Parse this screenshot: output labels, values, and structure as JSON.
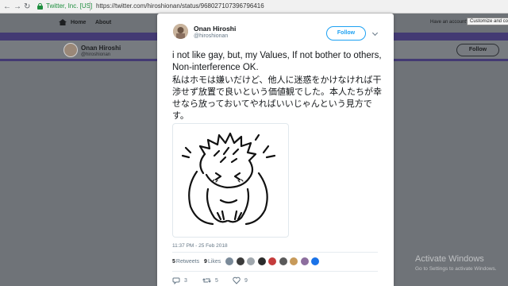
{
  "browser": {
    "back_icon": "back-arrow-icon",
    "forward_icon": "forward-arrow-icon",
    "reload_icon": "reload-icon",
    "secure_label": "Twitter, Inc. [US]",
    "url": "https://twitter.com/hiroshionan/status/968027107396796416",
    "tooltip": "Customize and cont"
  },
  "background": {
    "nav": {
      "home": "Home",
      "about": "About",
      "right_text": "Have an account?"
    },
    "profile": {
      "name": "Onan Hiroshi",
      "handle": "@hiroshionan",
      "follow_label": "Follow"
    },
    "band_color": "#433a73"
  },
  "tweet": {
    "author": {
      "name": "Onan Hiroshi",
      "handle": "@hiroshionan"
    },
    "follow_label": "Follow",
    "text_en": "i not like gay, but, my Values, If not bother to others, Non-interference OK.",
    "text_jp": "私はホモは嫌いだけど、他人に迷惑をかけなければ干渉せず放置で良いという価値観でした。本人たちが幸せなら放っておいてやればいいじゃんという見方です。",
    "media_description_icon": "bowing-boy-illustration",
    "timestamp": "11:37 PM - 25 Feb 2018",
    "stats": {
      "retweets_count": "5",
      "retweets_label": "Retweets",
      "likes_count": "9",
      "likes_label": "Likes"
    },
    "likers": [
      "#7a8a99",
      "#3b3b3b",
      "#a0a7ad",
      "#2c2c2c",
      "#c43c3c",
      "#5a5a5a",
      "#c79a5a",
      "#8d6e9e",
      "#1a73e8"
    ],
    "actions": {
      "replies": "3",
      "retweets": "5",
      "likes": "9"
    },
    "accent_color": "#1da1f2"
  },
  "os_watermark": {
    "line1": "Activate Windows",
    "line2": "Go to Settings to activate Windows."
  }
}
